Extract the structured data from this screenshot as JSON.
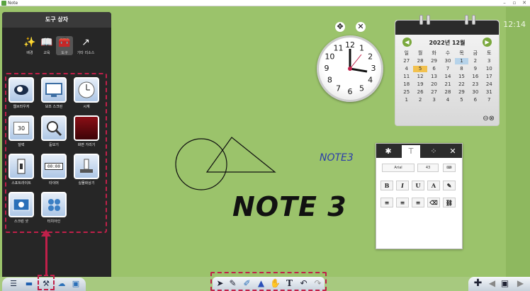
{
  "window": {
    "title": "Note",
    "controls": [
      "–",
      "▫",
      "✕"
    ]
  },
  "time": "12:14",
  "toolbox": {
    "title": "도구 상자",
    "categories": [
      {
        "label": "배경",
        "icon": "magic-wand-icon"
      },
      {
        "label": "교육",
        "icon": "book-icon"
      },
      {
        "label": "도구",
        "icon": "toolbox-icon"
      },
      {
        "label": "기타 리소스",
        "icon": "external-link-icon"
      }
    ],
    "tools": [
      {
        "label": "웹브라우저",
        "icon": "web-browser-icon"
      },
      {
        "label": "보조 스크린",
        "icon": "screen-icon"
      },
      {
        "label": "시계",
        "icon": "clock-icon"
      },
      {
        "label": "달력",
        "icon": "calendar-icon",
        "badge": "30"
      },
      {
        "label": "돋보기",
        "icon": "magnifier-icon"
      },
      {
        "label": "화면 가리기",
        "icon": "curtain-icon"
      },
      {
        "label": "스포트라이트",
        "icon": "spotlight-icon"
      },
      {
        "label": "타이머",
        "icon": "timer-icon",
        "badge": "00:00"
      },
      {
        "label": "실물화상기",
        "icon": "document-camera-icon"
      },
      {
        "label": "스크린 샷",
        "icon": "screenshot-icon"
      },
      {
        "label": "터치아인",
        "icon": "touch-icon"
      }
    ]
  },
  "calendar": {
    "title": "2022년 12월",
    "weekdays": [
      "일",
      "월",
      "화",
      "수",
      "목",
      "금",
      "토"
    ],
    "days": [
      "27",
      "28",
      "29",
      "30",
      "1",
      "2",
      "3",
      "4",
      "5",
      "6",
      "7",
      "8",
      "9",
      "10",
      "11",
      "12",
      "13",
      "14",
      "15",
      "16",
      "17",
      "18",
      "19",
      "20",
      "21",
      "22",
      "23",
      "24",
      "25",
      "26",
      "27",
      "28",
      "29",
      "30",
      "31",
      "1",
      "2",
      "3",
      "4",
      "5",
      "6",
      "7"
    ],
    "selected_index": 4,
    "today_index": 8
  },
  "clock_widget": {
    "numbers": [
      "12",
      "1",
      "2",
      "3",
      "4",
      "5",
      "6",
      "7",
      "8",
      "9",
      "10",
      "11"
    ]
  },
  "format_panel": {
    "font": "Arial",
    "size": "43",
    "buttons": [
      "B",
      "I",
      "U",
      "A",
      "✎"
    ]
  },
  "canvas_text": {
    "small": "NOTE3",
    "big": "NOTE 3"
  },
  "colors": {
    "board": "#9bc36b",
    "highlight": "#c0204a",
    "toolbox_bg": "#262626"
  }
}
